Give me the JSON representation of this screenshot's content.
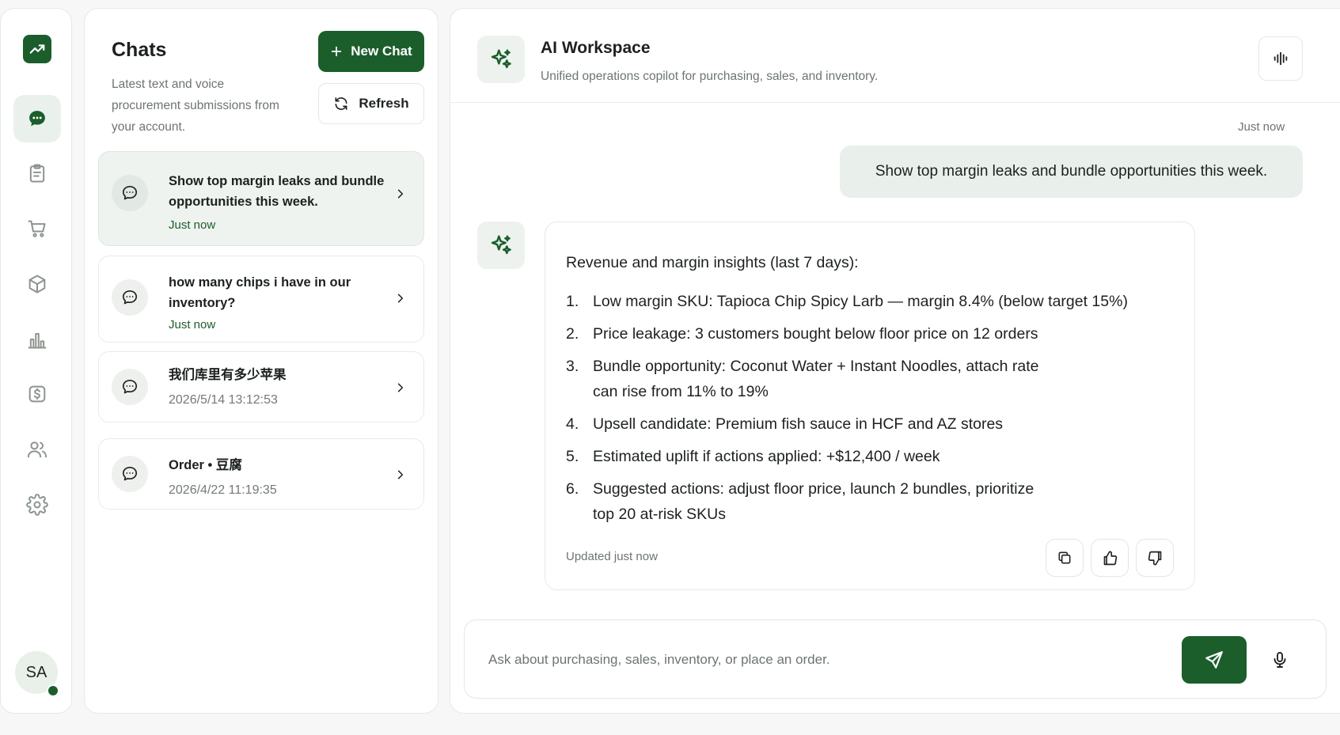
{
  "colors": {
    "accent": "#1b5e2c",
    "accent_soft": "#eaf1ec",
    "muted_text": "#6d756f"
  },
  "rail": {
    "logo_icon": "trending-up-icon",
    "items": [
      {
        "name": "chat",
        "icon": "chat-bubble-icon",
        "active": true
      },
      {
        "name": "orders",
        "icon": "clipboard-icon",
        "active": false
      },
      {
        "name": "purchasing",
        "icon": "cart-icon",
        "active": false
      },
      {
        "name": "inventory",
        "icon": "box-icon",
        "active": false
      },
      {
        "name": "analytics",
        "icon": "bar-chart-icon",
        "active": false
      },
      {
        "name": "finance",
        "icon": "dollar-icon",
        "active": false
      },
      {
        "name": "customers",
        "icon": "users-icon",
        "active": false
      },
      {
        "name": "settings",
        "icon": "gear-icon",
        "active": false
      }
    ],
    "avatar_initials": "SA"
  },
  "chats": {
    "title": "Chats",
    "subtitle": "Latest text and voice procurement submissions from your account.",
    "new_chat_label": "New Chat",
    "refresh_label": "Refresh",
    "items": [
      {
        "title": "Show top margin leaks and bundle opportunities this week.",
        "time": "Just now",
        "active": true
      },
      {
        "title": "how many chips i have in our inventory?",
        "time": "Just now",
        "active": false
      },
      {
        "title": "我们库里有多少苹果",
        "time": "2026/5/14 13:12:53",
        "active": false
      },
      {
        "title": "Order • 豆腐",
        "time": "2026/4/22 11:19:35",
        "active": false
      }
    ]
  },
  "workspace": {
    "title": "AI Workspace",
    "subtitle": "Unified operations copilot for purchasing, sales, and inventory.",
    "messages": {
      "user_time": "Just now",
      "user_text": "Show top margin leaks and bundle opportunities this week.",
      "ai_intro": "Revenue and margin insights (last 7 days):",
      "ai_items": [
        {
          "num": "1.",
          "text": "Low margin SKU: Tapioca Chip Spicy Larb — margin 8.4% (below target 15%)"
        },
        {
          "num": "2.",
          "text": "Price leakage: 3 customers bought below floor price on 12 orders"
        },
        {
          "num": "3.",
          "text": "Bundle opportunity: Coconut Water + Instant Noodles, attach rate can rise from 11% to 19%"
        },
        {
          "num": "4.",
          "text": "Upsell candidate: Premium fish sauce in HCF and AZ stores"
        },
        {
          "num": "5.",
          "text": "Estimated uplift if actions applied: +$12,400 / week"
        },
        {
          "num": "6.",
          "text": "Suggested actions: adjust floor price, launch 2 bundles, prioritize top 20 at-risk SKUs"
        }
      ],
      "ai_updated": "Updated just now"
    },
    "composer": {
      "placeholder": "Ask about purchasing, sales, inventory, or place an order.",
      "value": ""
    }
  }
}
